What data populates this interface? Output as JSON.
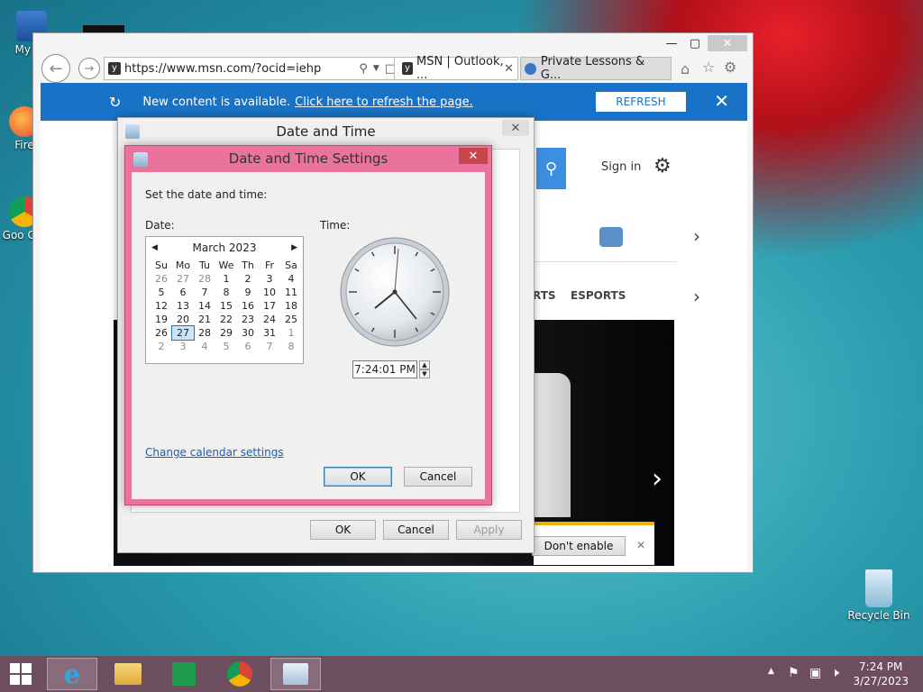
{
  "desktop": {
    "icons": [
      {
        "label": "My Co"
      },
      {
        "label": "Fire"
      },
      {
        "label": "Goo Chr"
      },
      {
        "label": "Recycle Bin"
      }
    ]
  },
  "browser": {
    "url": "https://www.msn.com/?ocid=iehp",
    "tabs": [
      {
        "label": "MSN | Outlook, ..."
      },
      {
        "label": "Private Lessons & G..."
      }
    ],
    "notification": {
      "text": "New content is available.",
      "link": "Click here to refresh the page.",
      "button": "REFRESH"
    },
    "page": {
      "sign_in": "Sign in",
      "nav": [
        "RTS",
        "ESPORTS"
      ],
      "security_button": "Don't enable"
    }
  },
  "date_time_dialog": {
    "title": "Date and Time",
    "ok": "OK",
    "cancel": "Cancel",
    "apply": "Apply"
  },
  "settings_dialog": {
    "title": "Date and Time Settings",
    "instruction": "Set the date and time:",
    "date_label": "Date:",
    "time_label": "Time:",
    "calendar": {
      "month_year": "March 2023",
      "weekdays": [
        "Su",
        "Mo",
        "Tu",
        "We",
        "Th",
        "Fr",
        "Sa"
      ],
      "weeks": [
        [
          "26",
          "27",
          "28",
          "1",
          "2",
          "3",
          "4"
        ],
        [
          "5",
          "6",
          "7",
          "8",
          "9",
          "10",
          "11"
        ],
        [
          "12",
          "13",
          "14",
          "15",
          "16",
          "17",
          "18"
        ],
        [
          "19",
          "20",
          "21",
          "22",
          "23",
          "24",
          "25"
        ],
        [
          "26",
          "27",
          "28",
          "29",
          "30",
          "31",
          "1"
        ],
        [
          "2",
          "3",
          "4",
          "5",
          "6",
          "7",
          "8"
        ]
      ],
      "selected": "27"
    },
    "time_value": "7:24:01 PM",
    "change_link": "Change calendar settings",
    "ok": "OK",
    "cancel": "Cancel"
  },
  "taskbar": {
    "time": "7:24 PM",
    "date": "3/27/2023"
  },
  "colors": {
    "ie_blue": "#1873c7",
    "dialog_pink": "#e9739d",
    "taskbar": "#6d4e5e"
  }
}
